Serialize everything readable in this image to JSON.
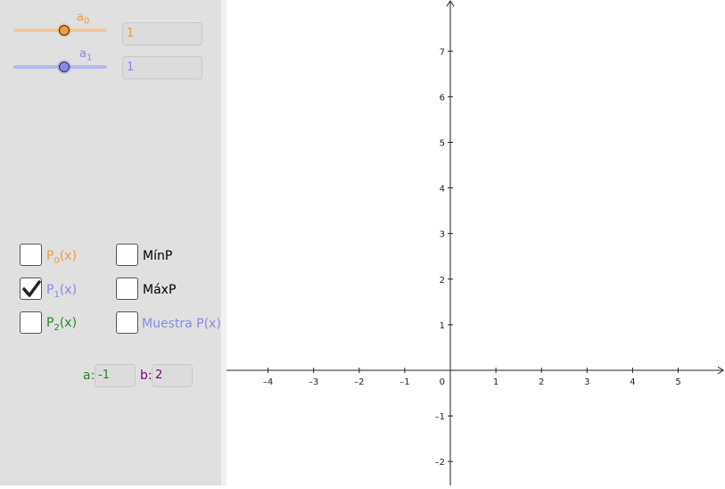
{
  "colors": {
    "orange": "#f29a3a",
    "blue": "#8888ee",
    "green": "#228b22",
    "purple": "#800080",
    "orange_track": "#f4c89a",
    "blue_track": "#b8b8f0"
  },
  "sliders": [
    {
      "name": "a",
      "sub": "0",
      "value": "1",
      "level_fraction": 0.55
    },
    {
      "name": "a",
      "sub": "1",
      "value": "1",
      "level_fraction": 0.55
    }
  ],
  "checkboxes": {
    "p0": {
      "label": "P",
      "sub": "0",
      "suffix": "(x)",
      "checked": false
    },
    "p1": {
      "label": "P",
      "sub": "1",
      "suffix": "(x)",
      "checked": true
    },
    "p2": {
      "label": "P",
      "sub": "2",
      "suffix": "(x)",
      "checked": false
    },
    "minp": {
      "label": "MínP",
      "checked": false
    },
    "maxp": {
      "label": "MáxP",
      "checked": false
    },
    "muestra": {
      "label": "Muestra P(x)",
      "checked": false
    }
  },
  "interval": {
    "a_label": "a:",
    "a_value": "-1",
    "b_label": "b:",
    "b_value": "2"
  },
  "graph": {
    "x_ticks": [
      "–4",
      "–3",
      "–2",
      "–1",
      "1",
      "2",
      "3",
      "4",
      "5"
    ],
    "x_tick_values": [
      -4,
      -3,
      -2,
      -1,
      1,
      2,
      3,
      4,
      5
    ],
    "y_ticks": [
      "7",
      "6",
      "5",
      "4",
      "3",
      "2",
      "1",
      "–1",
      "–2"
    ],
    "y_tick_values": [
      7,
      6,
      5,
      4,
      3,
      2,
      1,
      -1,
      -2
    ],
    "origin_label": "0",
    "x_range": [
      -4.9,
      6.0
    ],
    "y_range": [
      -2.5,
      8.1
    ]
  }
}
